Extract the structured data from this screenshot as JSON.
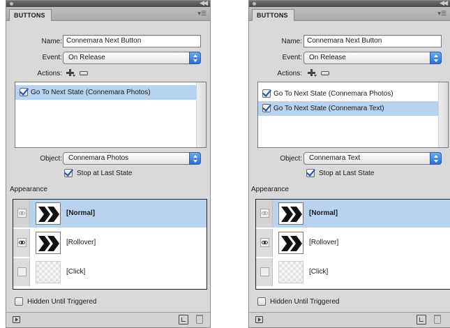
{
  "panels": [
    {
      "tab": "BUTTONS",
      "name_label": "Name:",
      "name_value": "Connemara Next Button",
      "event_label": "Event:",
      "event_value": "On Release",
      "actions_label": "Actions:",
      "actions": [
        {
          "label": "Go To Next State (Connemara Photos)",
          "checked": true,
          "selected": true
        }
      ],
      "object_label": "Object:",
      "object_value": "Connemara Photos",
      "stop_at_last_state": {
        "label": "Stop at Last State",
        "checked": true
      },
      "appearance_label": "Appearance",
      "states": [
        {
          "label": "[Normal]",
          "selected": true,
          "thumb": "chevrons-icon"
        },
        {
          "label": "[Rollover]",
          "selected": false,
          "thumb": "chevrons-icon"
        },
        {
          "label": "[Click]",
          "selected": false,
          "thumb": "empty"
        }
      ],
      "hidden_until_triggered": {
        "label": "Hidden Until Triggered",
        "checked": false
      }
    },
    {
      "tab": "BUTTONS",
      "name_label": "Name:",
      "name_value": "Connemara Next Button",
      "event_label": "Event:",
      "event_value": "On Release",
      "actions_label": "Actions:",
      "actions": [
        {
          "label": "Go To Next State (Connemara Photos)",
          "checked": true,
          "selected": false
        },
        {
          "label": "Go To Next State (Connemara Text)",
          "checked": true,
          "selected": true
        }
      ],
      "object_label": "Object:",
      "object_value": "Connemara Text",
      "stop_at_last_state": {
        "label": "Stop at Last State",
        "checked": true
      },
      "appearance_label": "Appearance",
      "states": [
        {
          "label": "[Normal]",
          "selected": true,
          "thumb": "chevrons-icon"
        },
        {
          "label": "[Rollover]",
          "selected": false,
          "thumb": "chevrons-icon"
        },
        {
          "label": "[Click]",
          "selected": false,
          "thumb": "empty"
        }
      ],
      "hidden_until_triggered": {
        "label": "Hidden Until Triggered",
        "checked": false
      }
    }
  ],
  "colors": {
    "selection": "#b7d3f0",
    "panel_bg": "#d9d9d9",
    "popup_arrow": "#2b6fd3"
  }
}
